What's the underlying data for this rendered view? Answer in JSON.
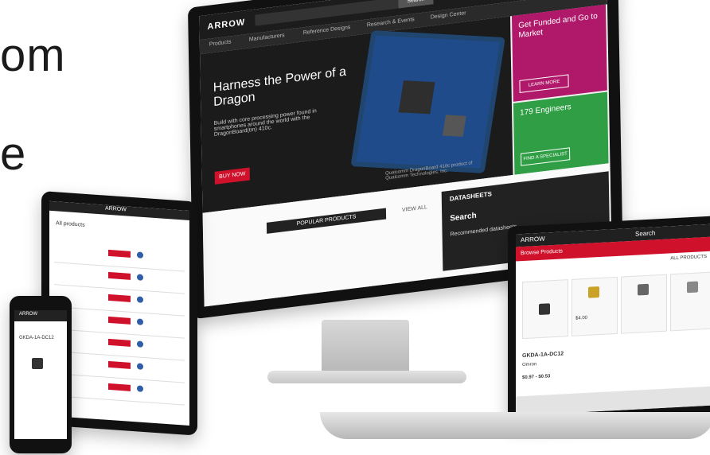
{
  "hero": {
    "line1": "om",
    "line2": "e"
  },
  "monitor": {
    "logo": "ARROW",
    "search_button": "Search",
    "nav_items": [
      "Products",
      "Manufacturers",
      "Reference Designs",
      "Research & Events",
      "Design Center"
    ],
    "hero": {
      "title": "Harness the Power of a Dragon",
      "description": "Build with core processing power found in smartphones around the world with the DragonBoard(tm) 410c.",
      "button": "BUY NOW",
      "board_caption": "Qualcomm DragonBoard 410c product of Qualcomm Technologies, Inc."
    },
    "side1": {
      "title": "Get Funded and Go to Market",
      "button": "LEARN MORE"
    },
    "side2": {
      "title": "179 Engineers",
      "button": "FIND A SPECIALIST"
    },
    "popular": "POPULAR PRODUCTS",
    "view_all": "VIEW ALL",
    "datasheets": {
      "title": "DATASHEETS",
      "search": "Search",
      "recommended": "Recommended datasheets"
    }
  },
  "laptop": {
    "red_bar": "Browse Products",
    "all_products": "ALL PRODUCTS",
    "search": "Search",
    "product1_price": "$4.00",
    "product_name": "GKDA-1A-DC12",
    "product_brand": "Omron",
    "product_price_range": "$0.97 - $0.53"
  },
  "tablet": {
    "title": "ARROW",
    "subtitle": "All products",
    "rows": 8
  },
  "phone": {
    "title": "ARROW",
    "item": "GKDA-1A-DC12"
  }
}
